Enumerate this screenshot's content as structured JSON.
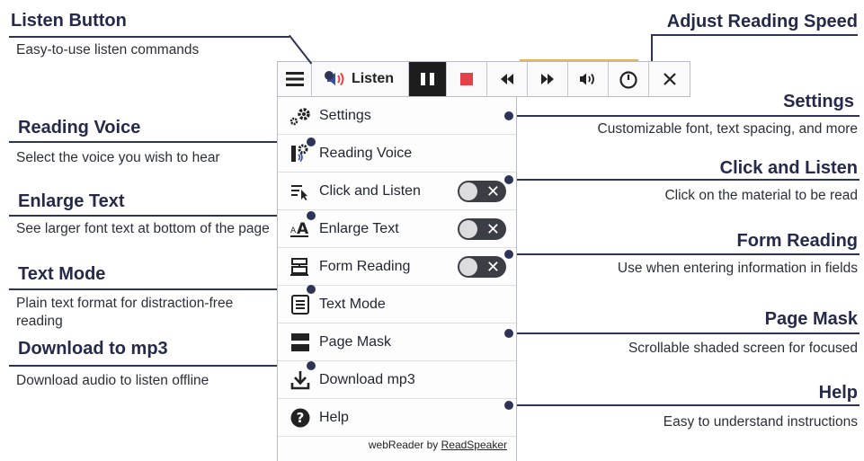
{
  "toolbar": {
    "listen_label": "Listen",
    "buttons": [
      "menu-icon",
      "speaker-icon",
      "pause-icon",
      "stop-icon",
      "rewind-icon",
      "fast-forward-icon",
      "volume-icon",
      "speed-dial-icon",
      "close-icon"
    ]
  },
  "menu": {
    "items": [
      {
        "label": "Settings",
        "icon": "gear-icon",
        "toggle": false
      },
      {
        "label": "Reading Voice",
        "icon": "voice-settings-icon",
        "toggle": false
      },
      {
        "label": "Click and Listen",
        "icon": "click-listen-icon",
        "toggle": true
      },
      {
        "label": "Enlarge Text",
        "icon": "enlarge-text-icon",
        "toggle": true
      },
      {
        "label": "Form Reading",
        "icon": "form-icon",
        "toggle": true
      },
      {
        "label": "Text Mode",
        "icon": "text-mode-icon",
        "toggle": false
      },
      {
        "label": "Page Mask",
        "icon": "page-mask-icon",
        "toggle": false
      },
      {
        "label": "Download mp3",
        "icon": "download-icon",
        "toggle": false
      },
      {
        "label": "Help",
        "icon": "help-icon",
        "toggle": false
      }
    ],
    "footer_prefix": "webReader by ",
    "footer_brand": "ReadSpeaker"
  },
  "callouts": {
    "listen_button": {
      "title": "Listen Button",
      "desc": "Easy-to-use listen commands"
    },
    "reading_voice": {
      "title": "Reading Voice",
      "desc": "Select the voice you wish to hear"
    },
    "enlarge_text": {
      "title": "Enlarge Text",
      "desc": "See larger font text at bottom of the page"
    },
    "text_mode": {
      "title": "Text Mode",
      "desc": "Plain text format for distraction-free reading"
    },
    "download": {
      "title": "Download to mp3",
      "desc": "Download audio to listen offline"
    },
    "adjust_speed": {
      "title": "Adjust Reading Speed"
    },
    "settings": {
      "title": "Settings",
      "desc": "Customizable font, text spacing, and more"
    },
    "click_listen": {
      "title": "Click and Listen",
      "desc": "Click on the material to be read"
    },
    "form_reading": {
      "title": "Form Reading",
      "desc": "Use when entering information in fields"
    },
    "page_mask": {
      "title": "Page Mask",
      "desc": "Scrollable shaded screen for focused"
    },
    "help": {
      "title": "Help",
      "desc": "Easy to understand instructions"
    }
  },
  "colors": {
    "accent_navy": "#2e3358",
    "stop_red": "#e34048",
    "progress_orange": "#f1b24a",
    "toggle_dark": "#3c3e45"
  }
}
